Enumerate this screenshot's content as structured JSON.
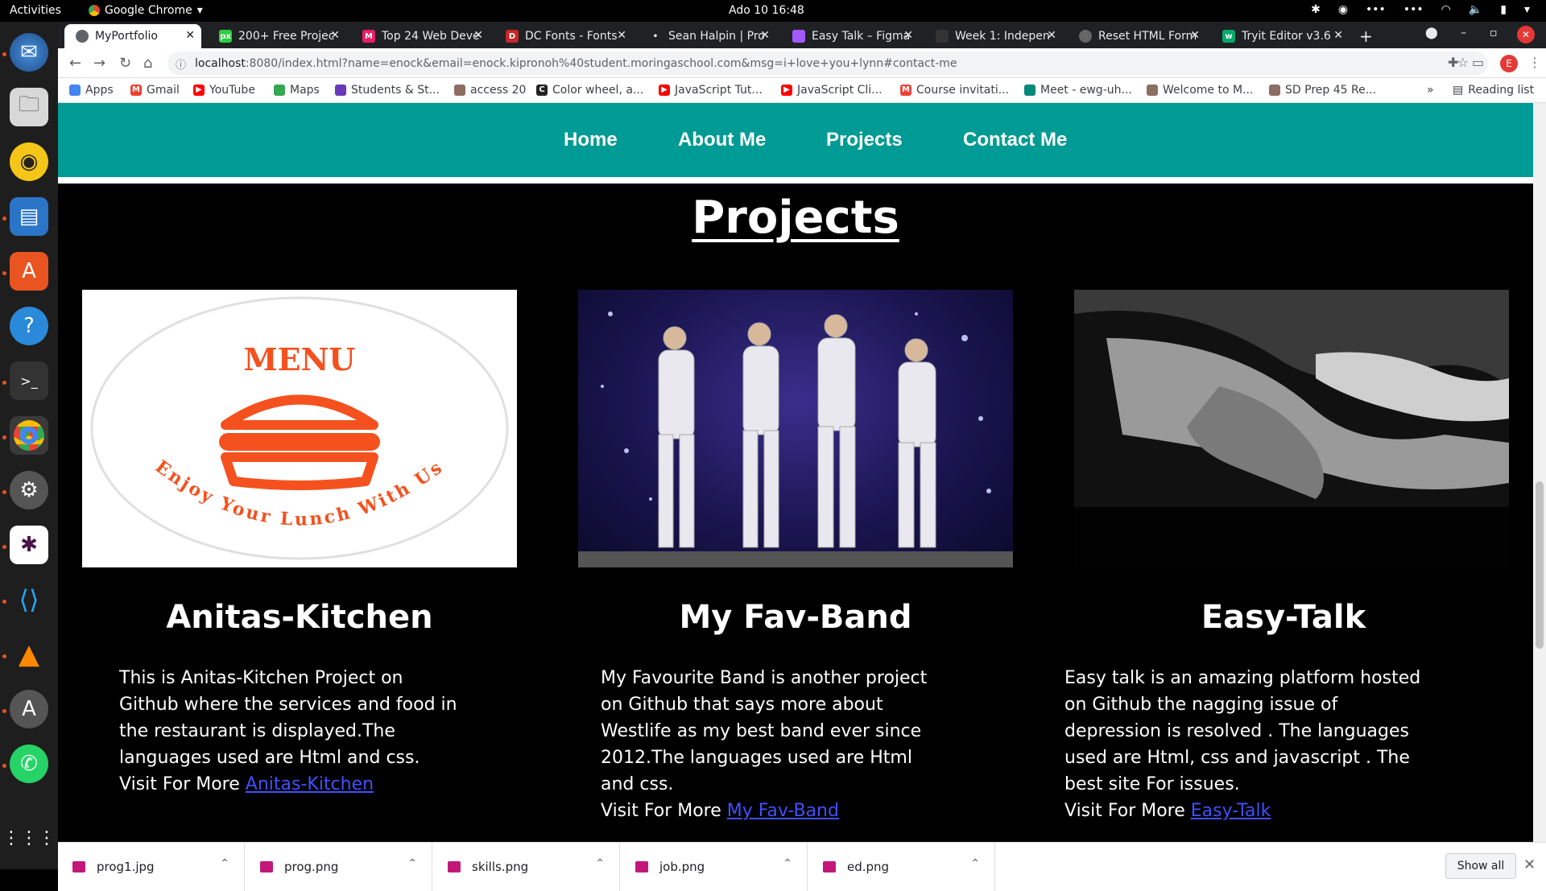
{
  "topbar": {
    "activities": "Activities",
    "app_name": "Google Chrome",
    "clock": "Ado 10  16:48"
  },
  "tabs": [
    {
      "label": "MyPortfolio",
      "active": true,
      "color": "#4285f4"
    },
    {
      "label": "200+ Free Projec",
      "color": "#2ecc40"
    },
    {
      "label": "Top 24 Web Deve",
      "color": "#e91e63"
    },
    {
      "label": "DC Fonts - Fonts",
      "color": "#c62828"
    },
    {
      "label": "Sean Halpin | Pro",
      "color": "#333333"
    },
    {
      "label": "Easy Talk – Figma",
      "color": "#a259ff"
    },
    {
      "label": "Week 1: Indepen",
      "color": "#333333"
    },
    {
      "label": "Reset HTML Form",
      "color": "#666666"
    },
    {
      "label": "Tryit Editor v3.6",
      "color": "#04aa6d"
    }
  ],
  "address": {
    "host": "localhost",
    "rest": ":8080/index.html?name=enock&email=enock.kipronoh%40student.moringaschool.com&msg=i+love+you+lynn#contact-me"
  },
  "profile_initial": "E",
  "bookmarks": [
    {
      "label": "Apps",
      "color": "#4285f4"
    },
    {
      "label": "Gmail",
      "color": "#ea4335"
    },
    {
      "label": "YouTube",
      "color": "#ff0000"
    },
    {
      "label": "Maps",
      "color": "#34a853"
    },
    {
      "label": "Students & St...",
      "color": "#673ab7"
    },
    {
      "label": "access 20",
      "color": "#8d6e63"
    },
    {
      "label": "Color wheel, a...",
      "color": "#222222"
    },
    {
      "label": "JavaScript Tut...",
      "color": "#ff0000"
    },
    {
      "label": "JavaScript Cli...",
      "color": "#ff0000"
    },
    {
      "label": "Course invitati...",
      "color": "#ea4335"
    },
    {
      "label": "Meet - ewg-uh...",
      "color": "#00897b"
    },
    {
      "label": "Welcome to M...",
      "color": "#8d6e63"
    },
    {
      "label": "SD Prep 45 Re...",
      "color": "#8d6e63"
    }
  ],
  "reading_list": "Reading list",
  "nav": {
    "home": "Home",
    "about": "About Me",
    "projects": "Projects",
    "contact": "Contact Me"
  },
  "section_title": "Projects",
  "projects": [
    {
      "title": "Anitas-Kitchen",
      "description": "This is Anitas-Kitchen Project on Github where the services and food in the restaurant is displayed.The languages used are Html and css.",
      "link_prefix": "Visit For More",
      "link_text": "Anitas-Kitchen",
      "menu_title": "MENU",
      "menu_tagline": "Enjoy Your Lunch With Us"
    },
    {
      "title": "My Fav-Band",
      "description": "My Favourite Band is another project on Github that says more about Westlife as my best band ever since 2012.The languages used are Html and css.",
      "link_prefix": "Visit For More",
      "link_text": "My Fav-Band"
    },
    {
      "title": "Easy-Talk",
      "description": "Easy talk is an amazing platform hosted on Github the nagging issue of depression is resolved . The languages used are Html, css and javascript . The best site For issues.",
      "link_prefix": "Visit For More",
      "link_text": "Easy-Talk"
    }
  ],
  "downloads": [
    {
      "name": "prog1.jpg"
    },
    {
      "name": "prog.png"
    },
    {
      "name": "skills.png"
    },
    {
      "name": "job.png"
    },
    {
      "name": "ed.png"
    }
  ],
  "show_all": "Show all",
  "colors": {
    "navbar": "#009b94",
    "link": "#3f51ff",
    "menu_orange": "#f4511e"
  }
}
